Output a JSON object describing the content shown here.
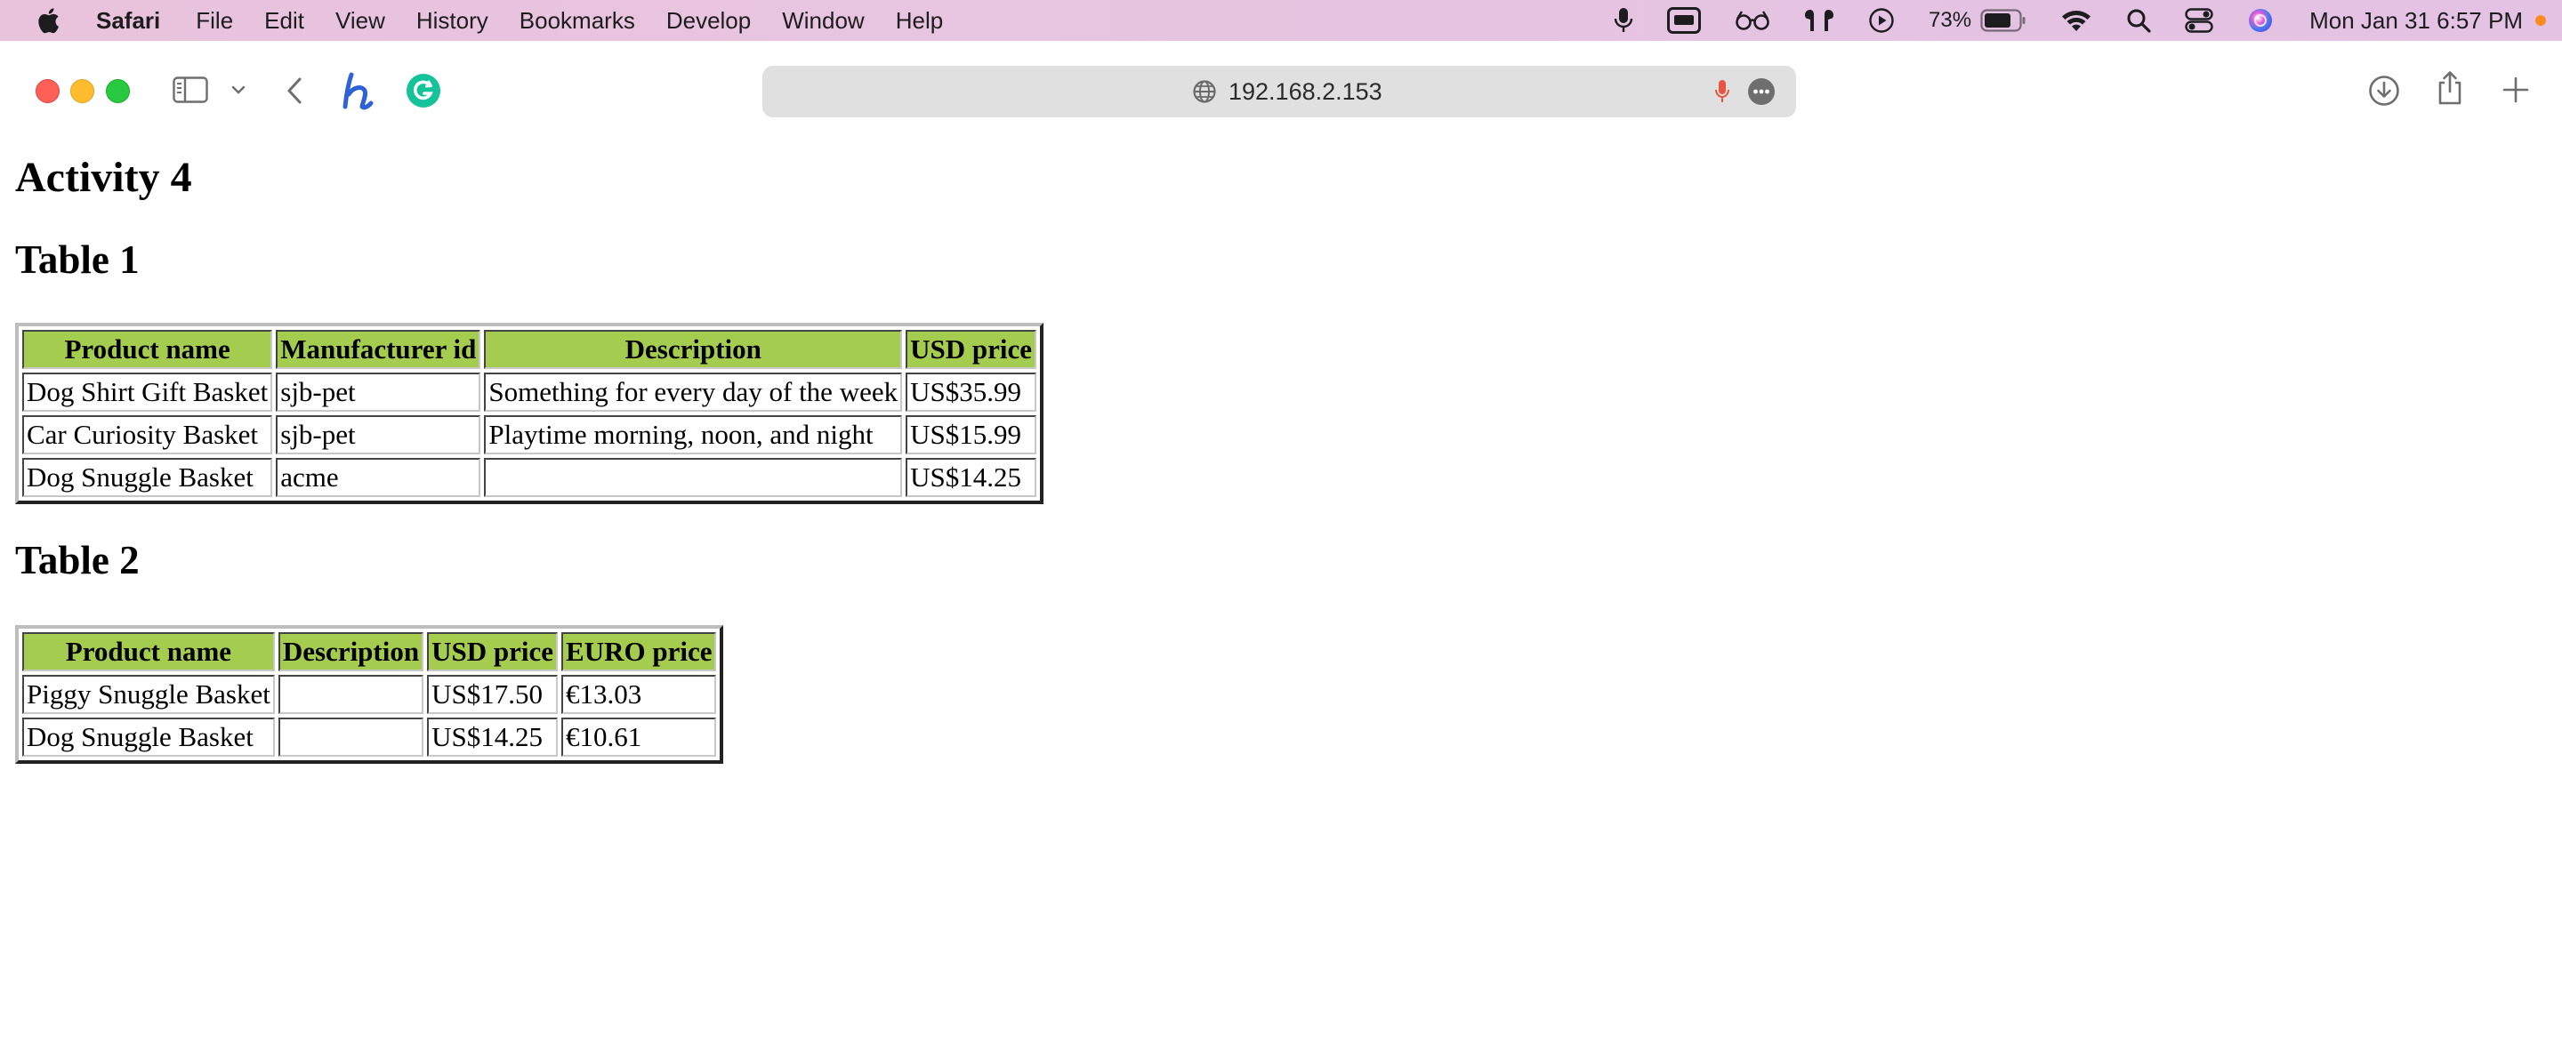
{
  "menubar": {
    "app_name": "Safari",
    "items": [
      "File",
      "Edit",
      "View",
      "History",
      "Bookmarks",
      "Develop",
      "Window",
      "Help"
    ],
    "status_icons": [
      "microphone-icon",
      "screen-share-icon",
      "reading-glasses-icon",
      "airpods-icon",
      "play-icon",
      "battery-icon",
      "wifi-icon",
      "search-icon",
      "control-center-icon",
      "siri-icon"
    ],
    "battery_percent": "73%",
    "clock": "Mon Jan 31  6:57 PM"
  },
  "toolbar": {
    "url": "192.168.2.153",
    "icons": [
      "sidebar-icon",
      "chevron-down-icon",
      "back-icon",
      "honey-extension-icon",
      "grammarly-extension-icon",
      "globe-icon",
      "microphone-icon",
      "more-icon",
      "download-icon",
      "share-icon",
      "new-tab-icon"
    ]
  },
  "page": {
    "title": "Activity 4",
    "table1": {
      "title": "Table 1",
      "headers": [
        "Product name",
        "Manufacturer id",
        "Description",
        "USD price"
      ],
      "rows": [
        [
          "Dog Shirt Gift Basket",
          "sjb-pet",
          "Something for every day of the week",
          "US$35.99"
        ],
        [
          "Car Curiosity Basket",
          "sjb-pet",
          "Playtime morning, noon, and night",
          "US$15.99"
        ],
        [
          "Dog Snuggle Basket",
          "acme",
          "",
          "US$14.25"
        ]
      ]
    },
    "table2": {
      "title": "Table 2",
      "headers": [
        "Product name",
        "Description",
        "USD price",
        "EURO price"
      ],
      "rows": [
        [
          "Piggy Snuggle Basket",
          "",
          "US$17.50",
          "€13.03"
        ],
        [
          "Dog Snuggle Basket",
          "",
          "US$14.25",
          "€10.61"
        ]
      ]
    }
  },
  "colors": {
    "header_cell_bg": "#a4cd4f",
    "menubar_bg": "#e8c3de",
    "url_bar_bg": "#e0e0e0",
    "close": "#fe5f57",
    "minimize": "#febc2e",
    "maximize": "#28c840",
    "honey": "#2e63d8",
    "grammarly": "#15c39a",
    "mic_red": "#e8563f"
  }
}
